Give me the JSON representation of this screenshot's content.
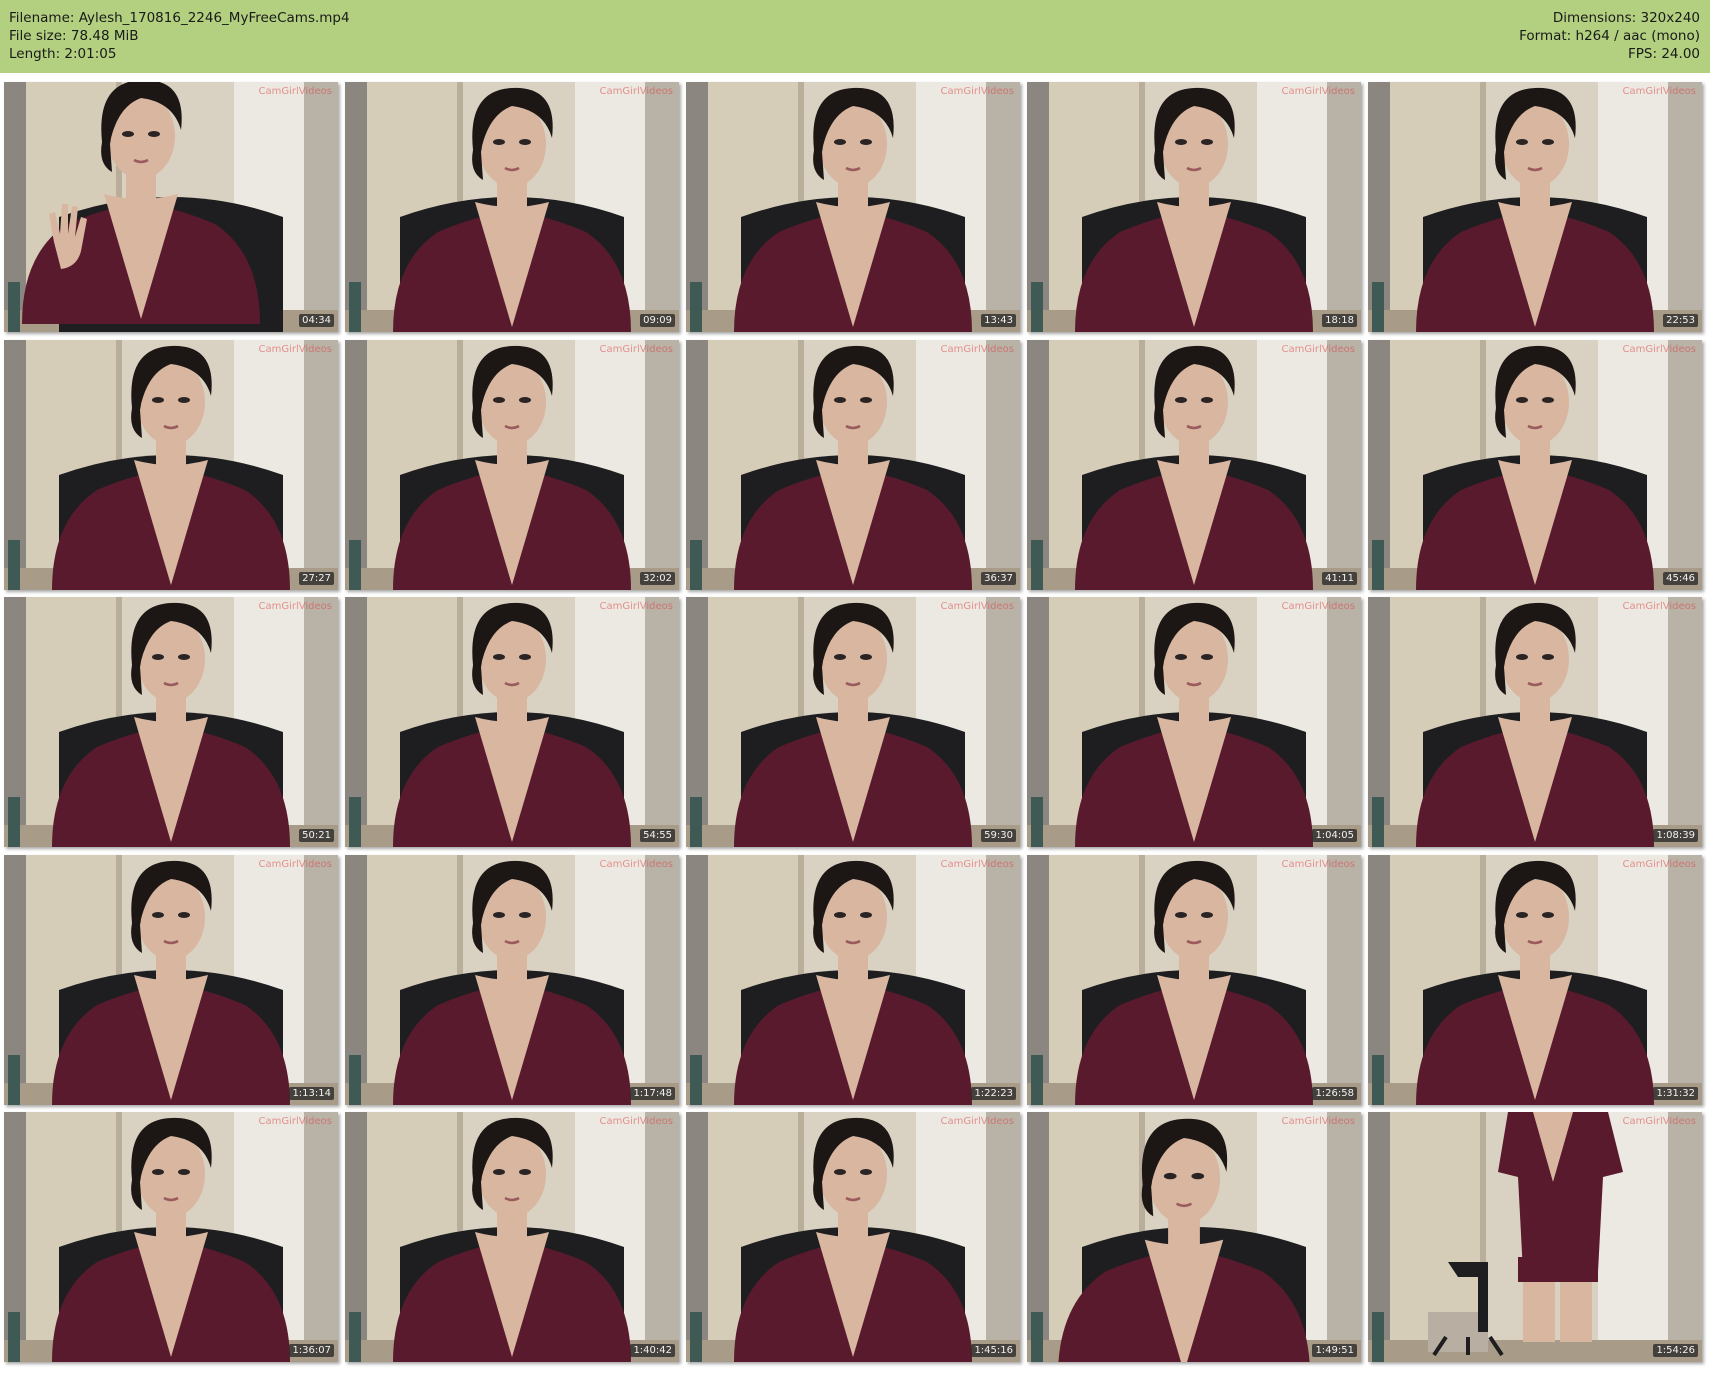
{
  "header": {
    "filename_line": "Filename: Aylesh_170816_2246_MyFreeCams.mp4",
    "filesize_line": "File size: 78.48 MiB",
    "length_line": "Length: 2:01:05",
    "dimensions_line": "Dimensions: 320x240",
    "format_line": "Format: h264 / aac (mono)",
    "fps_line": "FPS: 24.00",
    "background_color": "#b2d07f"
  },
  "watermark": "CamGirlVideos",
  "colors": {
    "shirt": "#5a1a2e",
    "hair": "#1c1614",
    "skin": "#d8b6a0",
    "chair": "#1e1e20",
    "wall": "#d9d2c2"
  },
  "thumbnails": [
    {
      "time": "04:34",
      "pose": "wave"
    },
    {
      "time": "09:09",
      "pose": "sit"
    },
    {
      "time": "13:43",
      "pose": "sit"
    },
    {
      "time": "18:18",
      "pose": "sit"
    },
    {
      "time": "22:53",
      "pose": "sit"
    },
    {
      "time": "27:27",
      "pose": "sit"
    },
    {
      "time": "32:02",
      "pose": "sit"
    },
    {
      "time": "36:37",
      "pose": "sit"
    },
    {
      "time": "41:11",
      "pose": "sit"
    },
    {
      "time": "45:46",
      "pose": "sit"
    },
    {
      "time": "50:21",
      "pose": "sit"
    },
    {
      "time": "54:55",
      "pose": "sit"
    },
    {
      "time": "59:30",
      "pose": "sit"
    },
    {
      "time": "1:04:05",
      "pose": "sit"
    },
    {
      "time": "1:08:39",
      "pose": "sit"
    },
    {
      "time": "1:13:14",
      "pose": "sit"
    },
    {
      "time": "1:17:48",
      "pose": "sit"
    },
    {
      "time": "1:22:23",
      "pose": "sit"
    },
    {
      "time": "1:26:58",
      "pose": "sit"
    },
    {
      "time": "1:31:32",
      "pose": "sit"
    },
    {
      "time": "1:36:07",
      "pose": "sit"
    },
    {
      "time": "1:40:42",
      "pose": "sit"
    },
    {
      "time": "1:45:16",
      "pose": "sit"
    },
    {
      "time": "1:49:51",
      "pose": "lean"
    },
    {
      "time": "1:54:26",
      "pose": "stand"
    }
  ]
}
